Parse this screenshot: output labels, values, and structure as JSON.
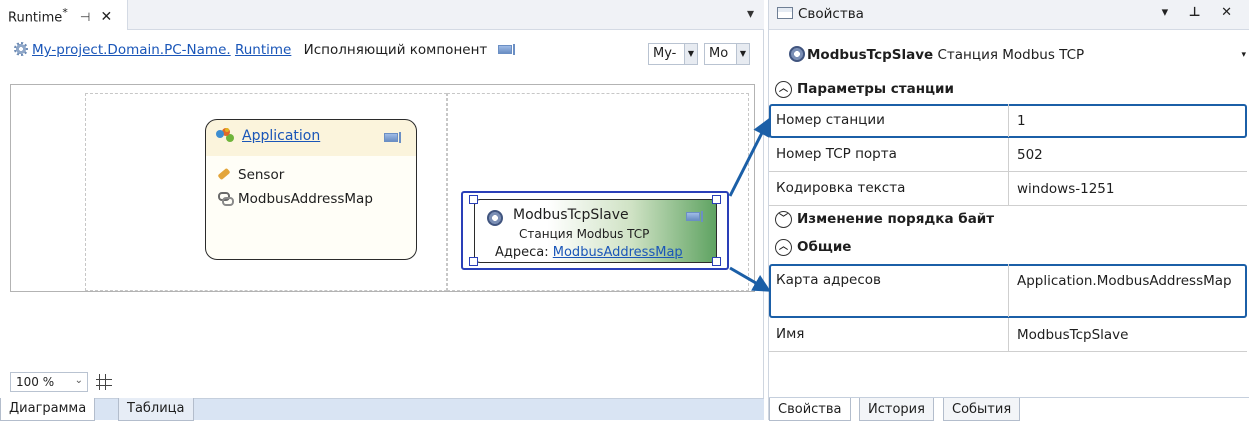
{
  "document": {
    "tab_title": "Runtime",
    "tab_modified": "*",
    "pin_glyph": "⊣",
    "close_glyph": "✕",
    "menu_glyph": "▾"
  },
  "breadcrumb": {
    "project": "My-project.",
    "domain": "Domain.",
    "pc": "PC-Name.",
    "runtime": "Runtime",
    "component_label": "Исполняющий компонент"
  },
  "combos": {
    "first": "My-",
    "second": "Mo"
  },
  "diagram": {
    "application": {
      "title": "Application",
      "items": [
        {
          "label": "Sensor",
          "icon": "pencil-icon"
        },
        {
          "label": "ModbusAddressMap",
          "icon": "chain-link-icon"
        }
      ]
    },
    "modbus_slave": {
      "title": "ModbusTcpSlave",
      "subtitle": "Станция Modbus TCP",
      "address_label": "Адреса: ",
      "address_link": "ModbusAddressMap"
    }
  },
  "zoom": {
    "value": "100 %",
    "arrow": "⌄"
  },
  "view_tabs": [
    {
      "label": "Диаграмма",
      "active": true
    },
    {
      "label": "Таблица",
      "active": false
    }
  ],
  "properties": {
    "title": "Свойства",
    "controls": "▾ ⊥ ✕",
    "object_name": "ModbusTcpSlave",
    "object_type": "Станция Modbus TCP",
    "dropdown_glyph": "▾",
    "categories": [
      {
        "label": "Параметры станции",
        "state": "expanded"
      },
      {
        "label": "Изменение порядка байт",
        "state": "collapsed"
      },
      {
        "label": "Общие",
        "state": "expanded"
      }
    ],
    "rows": [
      {
        "key": "Номер станции",
        "value": "1"
      },
      {
        "key": "Номер TCP порта",
        "value": "502"
      },
      {
        "key": "Кодировка текста",
        "value": "windows-1251"
      },
      {
        "key": "Карта адресов",
        "value": "Application.ModbusAddressMap"
      },
      {
        "key": "Имя",
        "value": "ModbusTcpSlave"
      }
    ],
    "tabs": [
      {
        "label": "Свойства",
        "active": true
      },
      {
        "label": "История",
        "active": false
      },
      {
        "label": "События",
        "active": false
      }
    ]
  },
  "colors": {
    "callout": "#1b5fa7",
    "selection": "#2a3fb8",
    "link": "#1a56b8"
  }
}
